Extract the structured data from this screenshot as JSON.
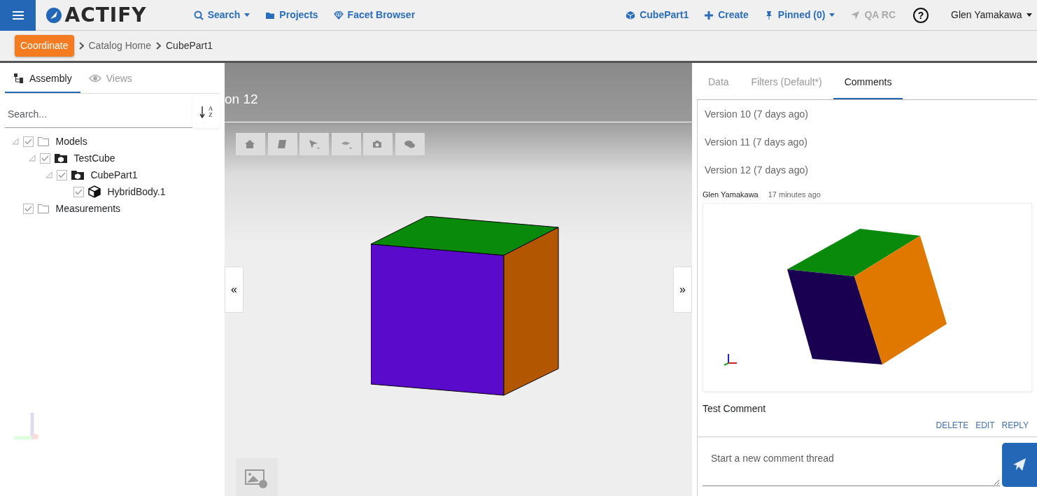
{
  "navbar": {
    "logo": "ACTIFY",
    "left_items": [
      {
        "label": "Search",
        "dropdown": true,
        "disabled": false
      },
      {
        "label": "Projects",
        "dropdown": false,
        "disabled": false
      },
      {
        "label": "Facet Browser",
        "dropdown": false,
        "disabled": false
      }
    ],
    "right_items": [
      {
        "label": "CubePart1",
        "dropdown": false,
        "disabled": false
      },
      {
        "label": "Create",
        "dropdown": false,
        "disabled": false
      },
      {
        "label": "Pinned (0)",
        "dropdown": true,
        "disabled": false
      },
      {
        "label": "QA RC",
        "dropdown": false,
        "disabled": true
      }
    ],
    "help": "?",
    "user": "Glen Yamakawa"
  },
  "breadcrumb": {
    "badge": "Coordinate",
    "items": [
      "Catalog Home",
      "CubePart1"
    ]
  },
  "left_panel": {
    "tabs": [
      {
        "label": "Assembly",
        "selected": true
      },
      {
        "label": "Views",
        "selected": false
      }
    ],
    "search": {
      "placeholder": "Search..."
    },
    "sort": {
      "top": "A",
      "bottom": "Z"
    },
    "tree": [
      {
        "label": "Models",
        "kind": "folder",
        "checked": true,
        "expanded": true,
        "children": [
          {
            "label": "TestCube",
            "kind": "assembly",
            "checked": true,
            "expanded": true,
            "children": [
              {
                "label": "CubePart1",
                "kind": "assembly",
                "checked": true,
                "expanded": true,
                "children": [
                  {
                    "label": "HybridBody.1",
                    "kind": "body",
                    "checked": true
                  }
                ]
              }
            ]
          }
        ]
      },
      {
        "label": "Measurements",
        "kind": "folder",
        "checked": true
      }
    ],
    "collapse": "«"
  },
  "viewer": {
    "title": "on 12",
    "expand": "»"
  },
  "right_panel": {
    "tabs": [
      {
        "label": "Data",
        "selected": false
      },
      {
        "label": "Filters (Default*)",
        "selected": false
      },
      {
        "label": "Comments",
        "selected": true
      }
    ],
    "versions": [
      "Version 10 (7 days ago)",
      "Version 11 (7 days ago)",
      "Version 12 (7 days ago)"
    ],
    "comment": {
      "author": "Glen Yamakawa",
      "time": "17 minutes ago",
      "text": "Test Comment",
      "actions": [
        "DELETE",
        "EDIT",
        "REPLY"
      ]
    },
    "new_comment": {
      "placeholder": "Start a new comment thread"
    }
  }
}
